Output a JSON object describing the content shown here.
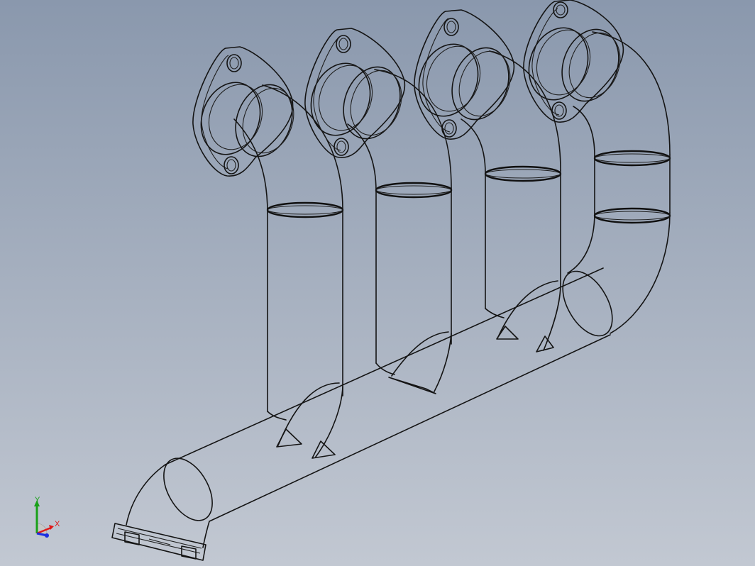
{
  "viewport": {
    "background_top": "#8a98ad",
    "background_bottom": "#c2c8d2",
    "edge_color": "#141414",
    "model_name": "exhaust-manifest-wireframe"
  },
  "triad": {
    "x_label": "X",
    "y_label": "Y",
    "x_color": "#e01818",
    "y_color": "#18a018",
    "z_color": "#1c2ee0"
  }
}
